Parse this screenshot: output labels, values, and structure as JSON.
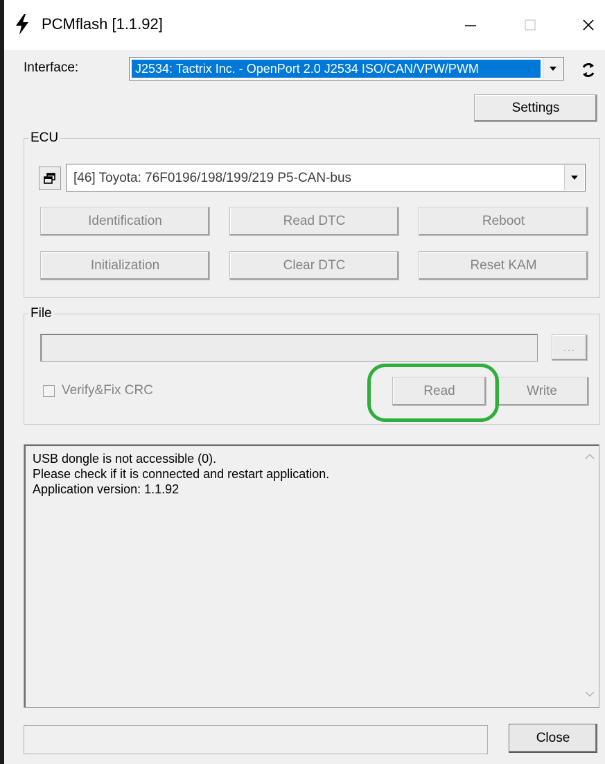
{
  "window": {
    "title": "PCMflash [1.1.92]",
    "minimize_label": "—",
    "close_label": "✕"
  },
  "interface": {
    "label": "Interface:",
    "selected": "J2534: Tactrix Inc. - OpenPort 2.0 J2534 ISO/CAN/VPW/PWM"
  },
  "settings_button": "Settings",
  "ecu": {
    "group_title": "ECU",
    "selected": "[46] Toyota: 76F0196/198/199/219 P5-CAN-bus",
    "buttons": {
      "identification": "Identification",
      "read_dtc": "Read DTC",
      "reboot": "Reboot",
      "initialization": "Initialization",
      "clear_dtc": "Clear DTC",
      "reset_kam": "Reset KAM"
    }
  },
  "file": {
    "group_title": "File",
    "path_value": "",
    "browse_label": "...",
    "verify_label": "Verify&Fix CRC",
    "verify_checked": false,
    "read_label": "Read",
    "write_label": "Write"
  },
  "log": {
    "lines": [
      "USB dongle is not accessible (0).",
      "Please check if it is connected and restart application.",
      "Application version: 1.1.92"
    ]
  },
  "status_text": "",
  "close_button": "Close",
  "colors": {
    "selection": "#0078d7",
    "highlight_ring": "#2fae3b",
    "disabled_text": "#838383"
  }
}
